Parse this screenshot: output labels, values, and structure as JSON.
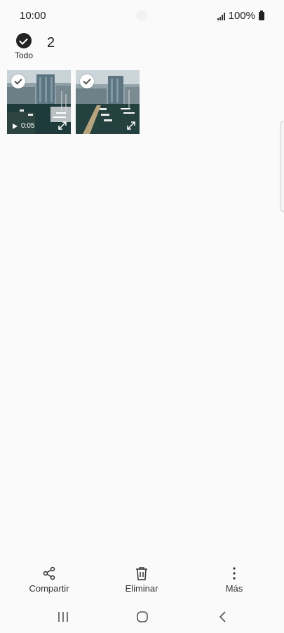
{
  "status_bar": {
    "time": "10:00",
    "battery": "100%",
    "icons": [
      "signal-icon",
      "battery-icon"
    ]
  },
  "selection": {
    "select_all_label": "Todo",
    "selected_count": "2"
  },
  "thumbnails": [
    {
      "type": "video",
      "duration": "0:05",
      "selected": true
    },
    {
      "type": "image",
      "selected": true
    }
  ],
  "actions": {
    "share_label": "Compartir",
    "delete_label": "Eliminar",
    "more_label": "Más"
  },
  "navigation": [
    "recents-icon",
    "home-icon",
    "back-icon"
  ],
  "colors": {
    "background": "#fafafa",
    "text": "#222222",
    "check": "#222222"
  }
}
